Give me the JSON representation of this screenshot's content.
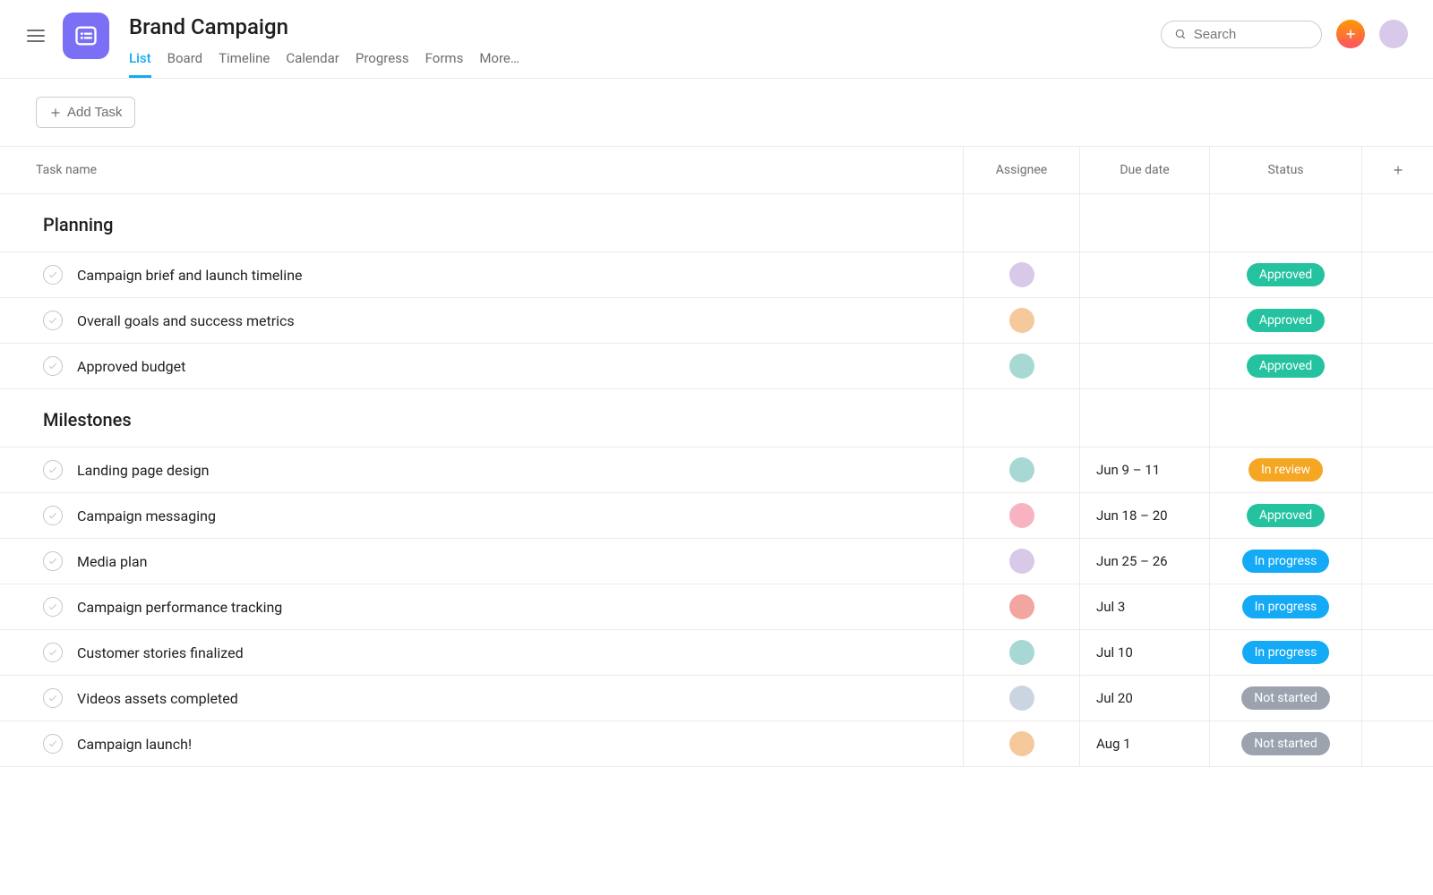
{
  "project": {
    "title": "Brand Campaign"
  },
  "tabs": [
    "List",
    "Board",
    "Timeline",
    "Calendar",
    "Progress",
    "Forms",
    "More…"
  ],
  "active_tab": "List",
  "search": {
    "placeholder": "Search"
  },
  "add_task_label": "Add Task",
  "columns": {
    "task": "Task name",
    "assignee": "Assignee",
    "due": "Due date",
    "status": "Status"
  },
  "avatar_colors": {
    "a1": "#d8c9e8",
    "a2": "#f5c99b",
    "a3": "#a7d8d4",
    "a4": "#f7b3c2",
    "a5": "#f3a6a0",
    "a6": "#cbd5e1"
  },
  "status_styles": {
    "Approved": "pill-approved",
    "In review": "pill-review",
    "In progress": "pill-progress",
    "Not started": "pill-notstarted"
  },
  "sections": [
    {
      "name": "Planning",
      "tasks": [
        {
          "name": "Campaign brief and launch timeline",
          "assignee": "a1",
          "due": "",
          "status": "Approved"
        },
        {
          "name": "Overall goals and success metrics",
          "assignee": "a2",
          "due": "",
          "status": "Approved"
        },
        {
          "name": "Approved budget",
          "assignee": "a3",
          "due": "",
          "status": "Approved"
        }
      ]
    },
    {
      "name": "Milestones",
      "tasks": [
        {
          "name": "Landing page design",
          "assignee": "a3",
          "due": "Jun 9 – 11",
          "status": "In review"
        },
        {
          "name": "Campaign messaging",
          "assignee": "a4",
          "due": "Jun 18 – 20",
          "status": "Approved"
        },
        {
          "name": "Media plan",
          "assignee": "a1",
          "due": "Jun 25 – 26",
          "status": "In progress"
        },
        {
          "name": "Campaign performance tracking",
          "assignee": "a5",
          "due": "Jul 3",
          "status": "In progress"
        },
        {
          "name": "Customer stories finalized",
          "assignee": "a3",
          "due": "Jul 10",
          "status": "In progress"
        },
        {
          "name": "Videos assets completed",
          "assignee": "a6",
          "due": "Jul 20",
          "status": "Not started"
        },
        {
          "name": "Campaign launch!",
          "assignee": "a2",
          "due": "Aug 1",
          "status": "Not started"
        }
      ]
    }
  ]
}
